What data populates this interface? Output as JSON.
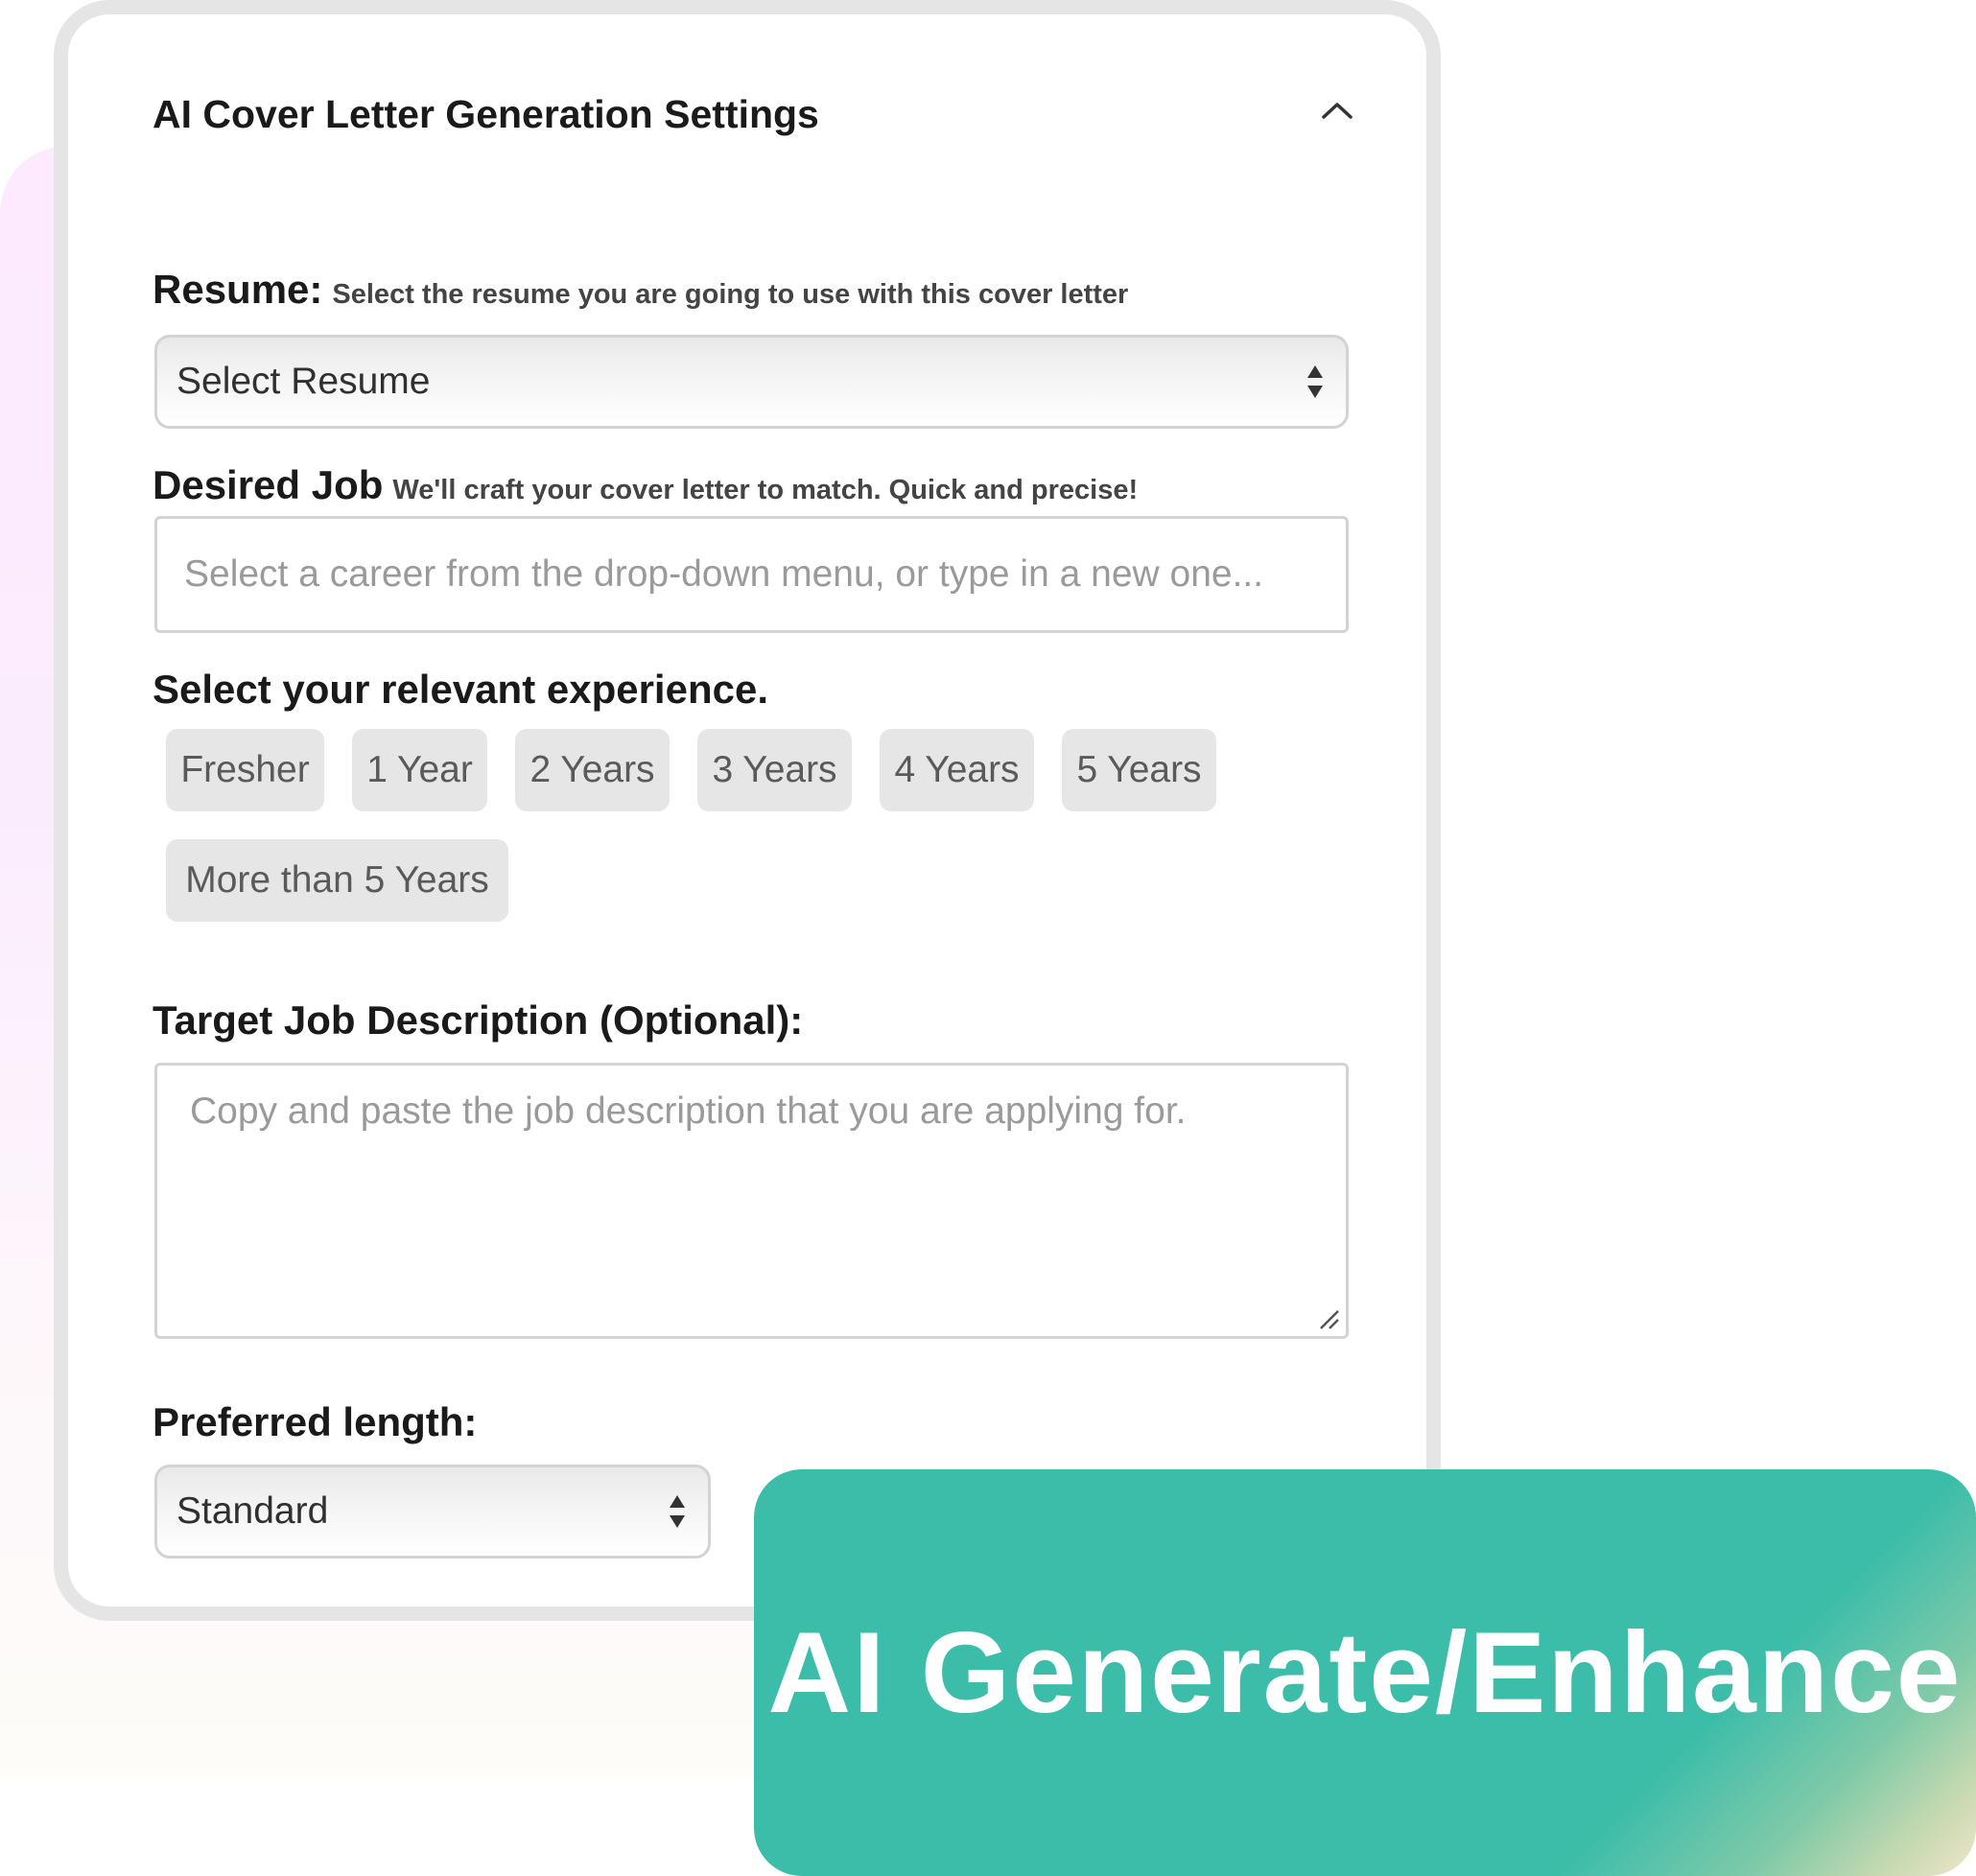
{
  "panel": {
    "title": "AI Cover Letter Generation Settings",
    "collapse_icon": "chevron-up-icon"
  },
  "resume": {
    "label": "Resume:",
    "hint": "Select the resume you are going to use with this cover letter",
    "selected": "Select Resume"
  },
  "desired_job": {
    "label": "Desired Job",
    "hint": "We'll craft your cover letter to match. Quick and precise!",
    "placeholder": "Select a career from the drop-down menu, or type in a new one..."
  },
  "experience": {
    "label": "Select your relevant experience.",
    "options": [
      "Fresher",
      "1 Year",
      "2 Years",
      "3 Years",
      "4 Years",
      "5 Years",
      "More than 5 Years"
    ]
  },
  "job_description": {
    "label": "Target Job Description (Optional):",
    "placeholder": "Copy and paste the job description that you are applying for."
  },
  "length": {
    "label": "Preferred length:",
    "selected": "Standard"
  },
  "cta": {
    "label": "AI Generate/Enhance"
  },
  "colors": {
    "accent": "#3bbdaa",
    "card_border": "#e5e5e5",
    "chip_bg": "#e6e6e6"
  }
}
